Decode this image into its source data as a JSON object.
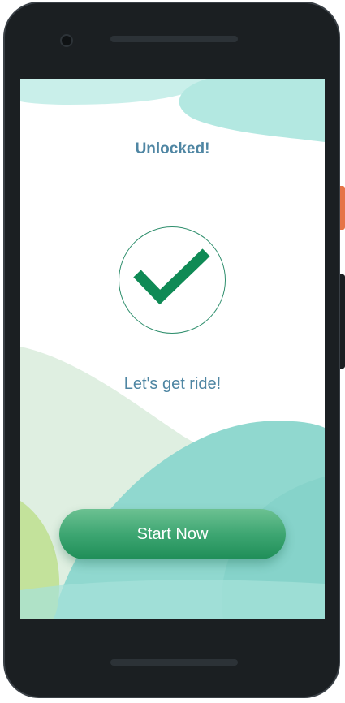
{
  "screen": {
    "title": "Unlocked!",
    "status_icon": "checkmark-icon",
    "message": "Let's get ride!",
    "primary_button_label": "Start Now"
  },
  "colors": {
    "title_text": "#4f86a3",
    "check_green": "#0f8a55",
    "button_green": "#3ea672",
    "teal_shape": "#8ad8cf",
    "light_green_shape": "#dcefdf",
    "lime_shape": "#c3e29b"
  }
}
